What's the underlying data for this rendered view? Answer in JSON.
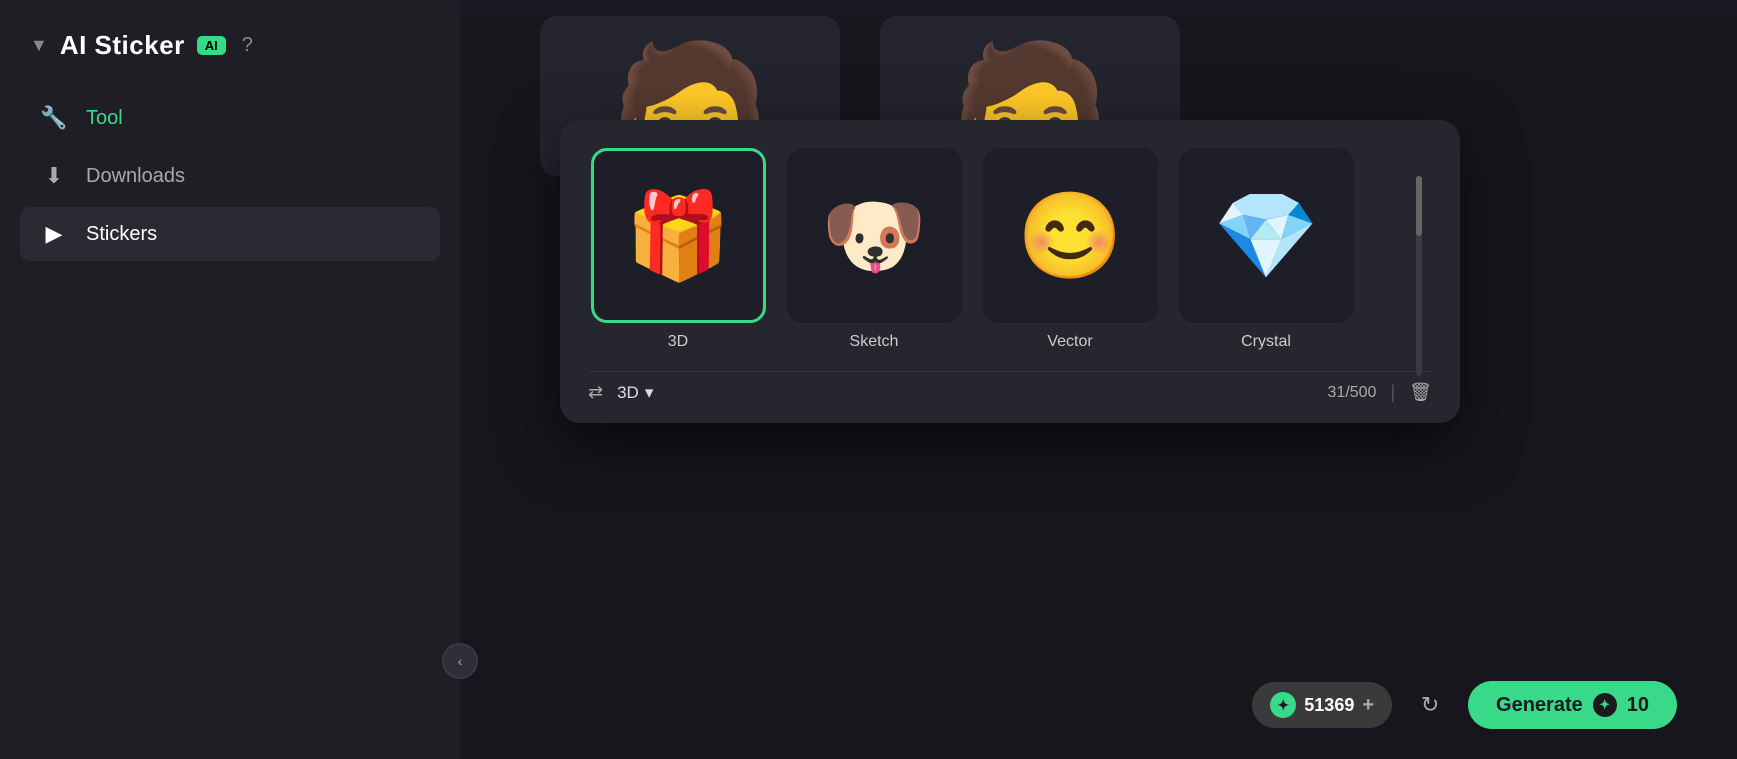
{
  "app": {
    "title": "AI Sticker",
    "ai_badge": "AI",
    "help_icon": "?",
    "chevron": "▼"
  },
  "sidebar": {
    "tool_label": "Tool",
    "downloads_label": "Downloads",
    "stickers_label": "Stickers",
    "collapse_icon": "‹"
  },
  "style_picker": {
    "options": [
      {
        "id": "3d",
        "label": "3D",
        "emoji": "🎁",
        "selected": true
      },
      {
        "id": "sketch",
        "label": "Sketch",
        "emoji": "🐶",
        "selected": false
      },
      {
        "id": "vector",
        "label": "Vector",
        "emoji": "😊",
        "selected": false
      },
      {
        "id": "crystal",
        "label": "Crystal",
        "emoji": "💎",
        "selected": false
      }
    ],
    "current_style": "3D",
    "count": "31/500",
    "shuffle_label": "shuffle",
    "dropdown_arrow": "▾",
    "trash_label": "trash"
  },
  "action_bar": {
    "credits": "51369",
    "add_label": "+",
    "generate_label": "Generate",
    "generate_cost": "10",
    "coin_symbol": "✦"
  },
  "characters": [
    {
      "emoji": "🧑"
    },
    {
      "emoji": "🧑"
    }
  ]
}
